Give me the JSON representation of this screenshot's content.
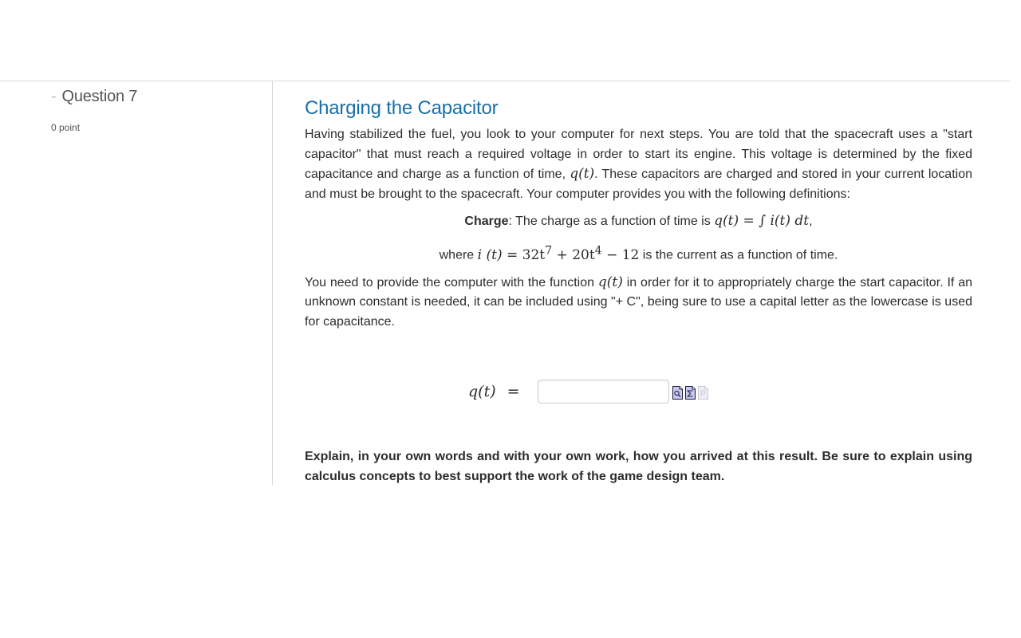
{
  "question": {
    "collapse_toggle": "-",
    "label": "Question 7",
    "points": "0 point"
  },
  "main": {
    "title": "Charging the Capacitor",
    "intro_before_q": "Having stabilized the fuel, you look to your computer for next steps. You are told that the spacecraft uses a \"start capacitor\" that must reach a required voltage in order to start its engine. This voltage is determined by the fixed capacitance and charge as a function of time, ",
    "intro_q_math": "q(t)",
    "intro_after_q": ". These capacitors are charged and stored in your current location and must be brought to the spacecraft. Your computer provides you with the following definitions:",
    "definition": {
      "term": "Charge",
      "text": ": The charge as a function of time is ",
      "formula": "q(t) = ∫ i(t) dt",
      "trailing": ","
    },
    "current": {
      "prefix": "where ",
      "formula_lhs": "i (t) = ",
      "formula_rhs_a": "32t",
      "exp_a": "7",
      "formula_rhs_b": " + 20t",
      "exp_b": "4",
      "formula_rhs_c": " − 12",
      "suffix": " is the current as a function of time."
    },
    "instruction_before": "You need to provide the computer with the function ",
    "instruction_math": "q(t)",
    "instruction_after": " in order for it to appropriately charge the start capacitor. If an unknown constant is needed, it can be included using \"+ C\", being sure to use a capital letter as the lowercase is used for capacitance."
  },
  "answer": {
    "label_q": "q",
    "label_paren": "(t)",
    "equals": "=",
    "input_value": "",
    "input_placeholder": "",
    "icons": [
      "preview-icon",
      "equation-editor-icon",
      "paste-disabled-icon"
    ]
  },
  "explain": {
    "text": "Explain, in your own words and with your own work, how you arrived at this result. Be sure to explain using calculus concepts to best support the work of the game design team."
  },
  "colors": {
    "title": "#1a6fa8",
    "text": "#2d2d2d",
    "muted": "#555555",
    "icon_fill": "#c8c8f0",
    "icon_disabled": "#e4e4ee"
  }
}
